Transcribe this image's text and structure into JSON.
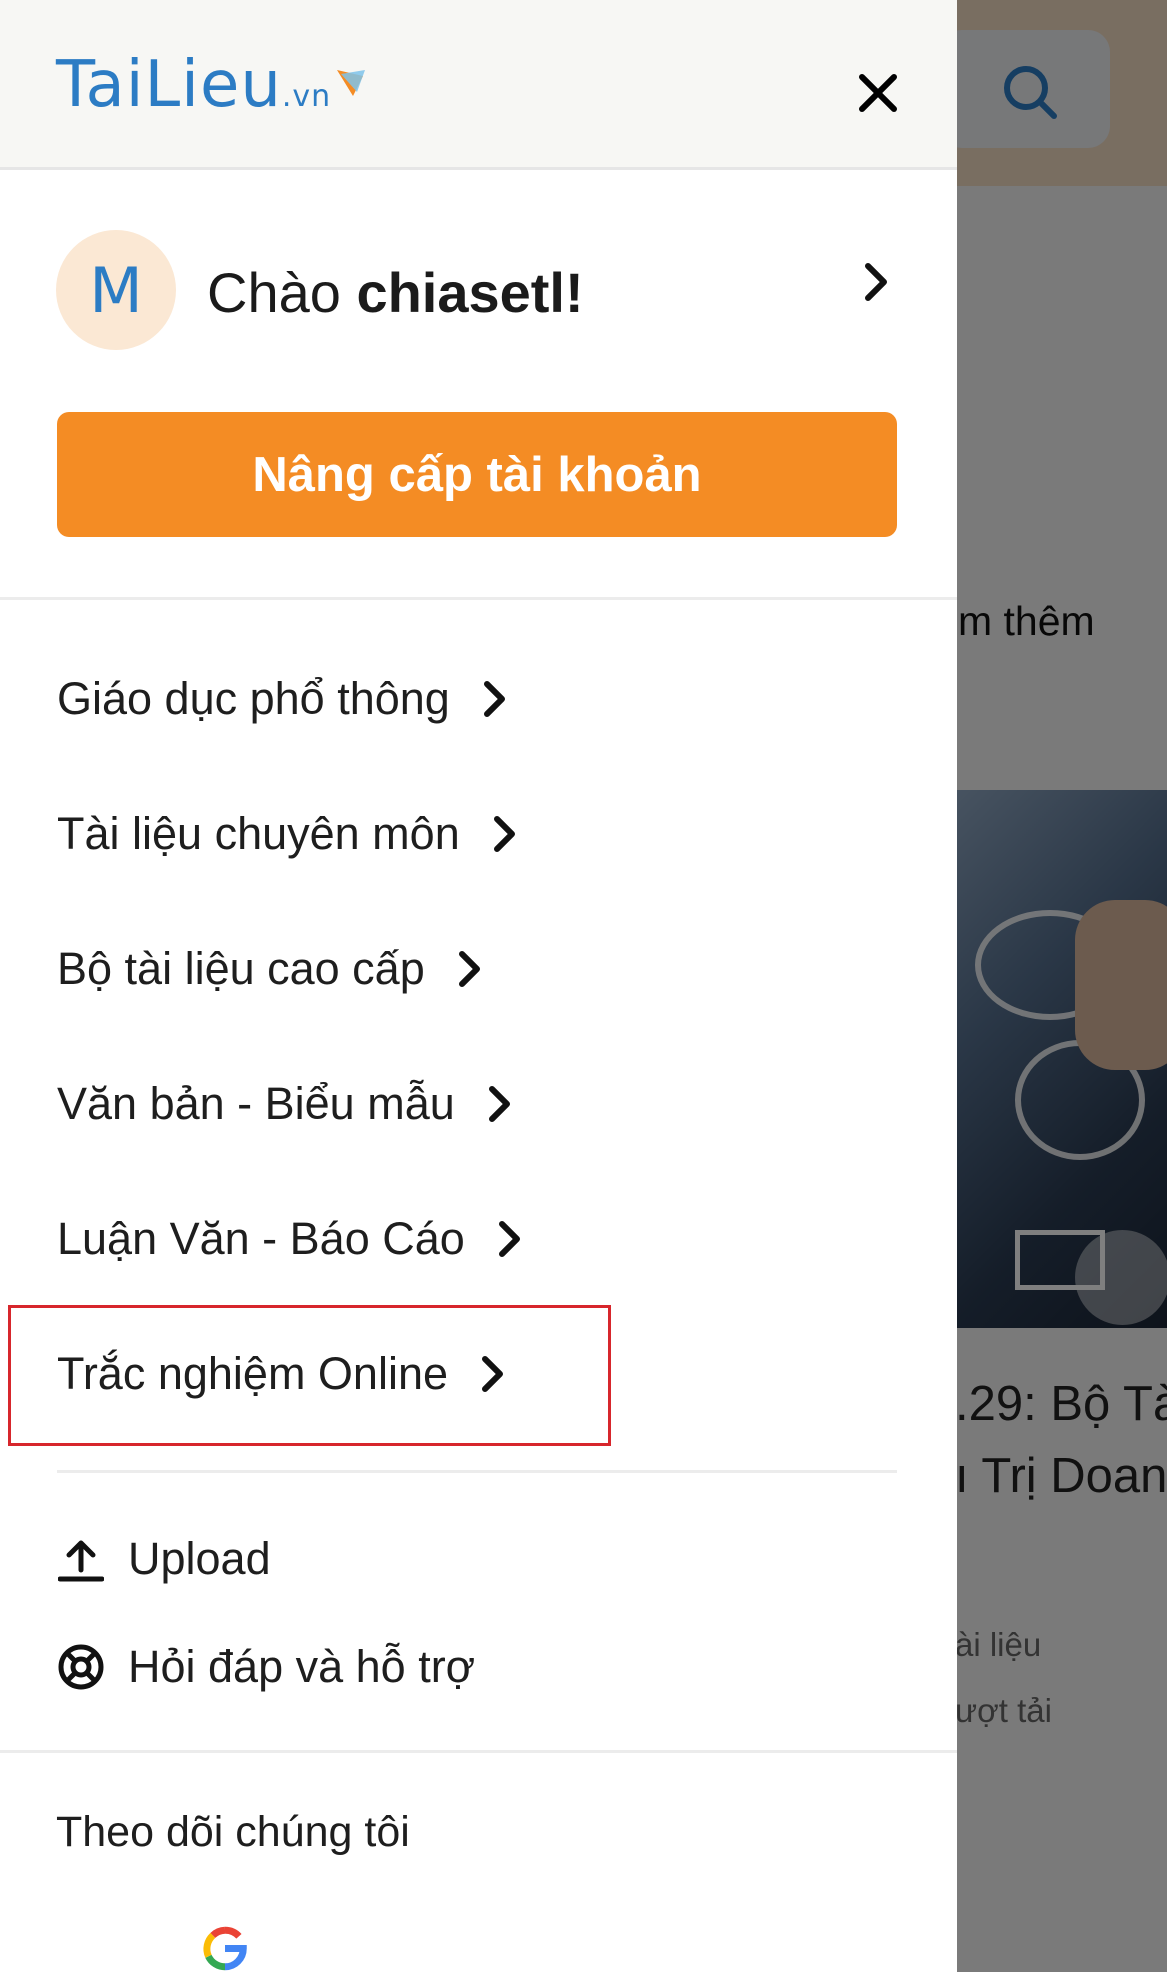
{
  "background": {
    "more_text": "m thêm",
    "article_title_line1": ".29: Bộ Tà",
    "article_title_line2": "ı Trị Doan",
    "meta_line1": "ài liệu",
    "meta_line2": "ượt tải"
  },
  "drawer": {
    "logo_text": "TaiLieu",
    "logo_tld": ".vn",
    "profile": {
      "avatar_letter": "M",
      "greeting_prefix": "Chào ",
      "username": "chiasetl!"
    },
    "upgrade_label": "Nâng cấp tài khoản",
    "menu": [
      {
        "label": "Giáo dục phổ thông"
      },
      {
        "label": "Tài liệu chuyên môn"
      },
      {
        "label": "Bộ tài liệu cao cấp"
      },
      {
        "label": "Văn bản - Biểu mẫu"
      },
      {
        "label": "Luận Văn - Báo Cáo"
      },
      {
        "label": "Trắc nghiệm Online"
      }
    ],
    "actions": {
      "upload_label": "Upload",
      "help_label": "Hỏi đáp và hỗ trợ"
    },
    "follow_label": "Theo dõi chúng tôi"
  },
  "colors": {
    "brand_blue": "#2c7cc4",
    "accent_orange": "#f48c24",
    "highlight_red": "#d7262c"
  },
  "icons": [
    "close-icon",
    "chevron-right-icon",
    "upload-icon",
    "lifebuoy-icon",
    "search-icon",
    "google-icon"
  ]
}
